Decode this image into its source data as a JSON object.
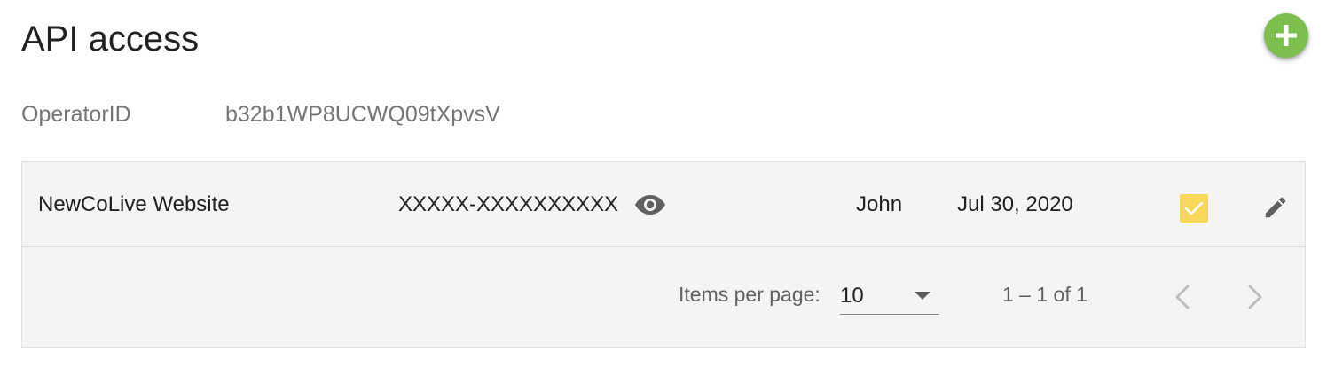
{
  "page": {
    "title": "API access"
  },
  "operator": {
    "label": "OperatorID",
    "value": "b32b1WP8UCWQ09tXpvsV"
  },
  "rows": [
    {
      "name": "NewCoLive Website",
      "key": "XXXXX-XXXXXXXXXX",
      "user": "John",
      "date": "Jul 30, 2020",
      "checked": true
    }
  ],
  "paginator": {
    "items_per_page_label": "Items per page:",
    "items_per_page_value": "10",
    "range_label": "1 – 1 of 1"
  },
  "icons": {
    "add": "plus-icon",
    "reveal": "eye-icon",
    "check": "check-icon",
    "edit": "pencil-icon",
    "prev": "chevron-left-icon",
    "next": "chevron-right-icon"
  },
  "colors": {
    "fab": "#7cbf4f",
    "checkbox": "#f7d85a",
    "table_bg": "#f4f4f4"
  }
}
